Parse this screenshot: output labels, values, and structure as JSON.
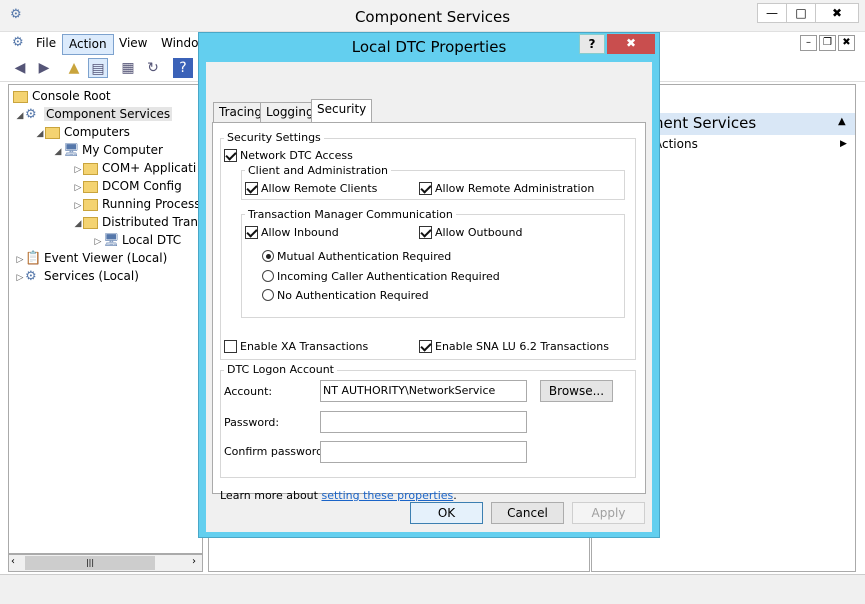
{
  "window": {
    "title": "Component Services",
    "min_label": "—",
    "max_label": "□",
    "close_label": "✖"
  },
  "menu": [
    "File",
    "Action",
    "View",
    "Windo"
  ],
  "inner_win": {
    "min": "–",
    "restore": "❐",
    "close": "✖"
  },
  "tree": {
    "items": [
      "Console Root",
      "Component Services",
      "Computers",
      "My Computer",
      "COM+ Applicati",
      "DCOM Config",
      "Running Process",
      "Distributed Trans",
      "Local DTC",
      "Event Viewer (Local)",
      "Services (Local)"
    ]
  },
  "actions": {
    "header": "nent Services",
    "item": "Actions"
  },
  "dialog": {
    "title": "Local DTC Properties",
    "help": "?",
    "close": "✖",
    "tabs": [
      "Tracing",
      "Logging",
      "Security"
    ],
    "security_settings": "Security Settings",
    "network_dtc_access": "Network DTC Access",
    "client_admin": "Client and Administration",
    "allow_remote_clients": "Allow Remote Clients",
    "allow_remote_admin": "Allow Remote Administration",
    "tm_comm": "Transaction Manager Communication",
    "allow_inbound": "Allow Inbound",
    "allow_outbound": "Allow Outbound",
    "mutual_auth": "Mutual Authentication Required",
    "incoming_caller": "Incoming Caller Authentication Required",
    "no_auth": "No Authentication Required",
    "enable_xa": "Enable XA Transactions",
    "enable_sna": "Enable SNA LU 6.2 Transactions",
    "logon_group": "DTC Logon Account",
    "account_label": "Account:",
    "account_value": "NT AUTHORITY\\NetworkService",
    "browse": "Browse...",
    "password_label": "Password:",
    "confirm_label": "Confirm password:",
    "learn_more": "Learn more about",
    "learn_link": "setting these properties",
    "learn_end": ".",
    "ok": "OK",
    "cancel": "Cancel",
    "apply": "Apply"
  },
  "colors": {
    "accent": "#63cfef",
    "close_red": "#c94e4e",
    "link": "#1a64c8"
  }
}
